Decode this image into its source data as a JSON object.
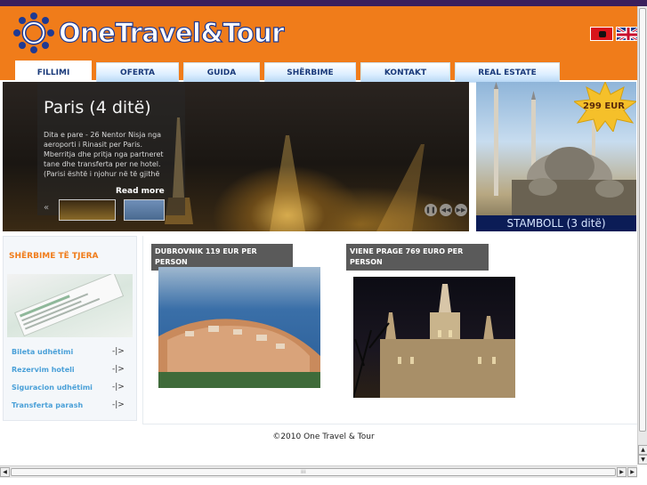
{
  "site": {
    "logo_text": "OneTravel&Tour"
  },
  "languages": [
    {
      "name": "Albanian",
      "icon": "flag-al-icon"
    },
    {
      "name": "English",
      "icon": "flag-uk-icon"
    }
  ],
  "nav": {
    "tabs": [
      {
        "label": "FILLIMI",
        "active": true
      },
      {
        "label": "OFERTA",
        "active": false
      },
      {
        "label": "GUIDA",
        "active": false
      },
      {
        "label": "SHËRBIME",
        "active": false
      },
      {
        "label": "KONTAKT",
        "active": false
      },
      {
        "label": "REAL ESTATE",
        "active": false
      }
    ]
  },
  "slider": {
    "title": "Paris (4 ditë)",
    "text": "Dita e pare - 26 Nentor Nisja nga aeroporti i Rinasit per Paris. Mberritja dhe pritja nga partneret tane dhe transferta per ne hotel. (Parisi është i njohur në të gjithë",
    "read_more": "Read more",
    "prev_symbol": "«",
    "controls": {
      "pause": "❚❚",
      "prev": "◀◀",
      "next": "▶▶"
    }
  },
  "promo": {
    "price": "299 EUR",
    "caption": "STAMBOLL (3 ditë)"
  },
  "services": {
    "title": "SHËRBIME TË TJERA",
    "items": [
      {
        "label": "Bileta udhëtimi"
      },
      {
        "label": "Rezervim hoteli"
      },
      {
        "label": "Siguracion udhëtimi"
      },
      {
        "label": "Transferta parash"
      }
    ]
  },
  "offers": [
    {
      "label": "DUBROVNIK 119 EUR PER PERSON"
    },
    {
      "label": "VIENE PRAGE 769 EURO PER PERSON"
    }
  ],
  "footer": {
    "text": "©2010 One Travel & Tour"
  },
  "colors": {
    "brand_orange": "#f07c1a",
    "nav_blue": "#1a3a7a",
    "link_blue": "#4aa0d8"
  }
}
